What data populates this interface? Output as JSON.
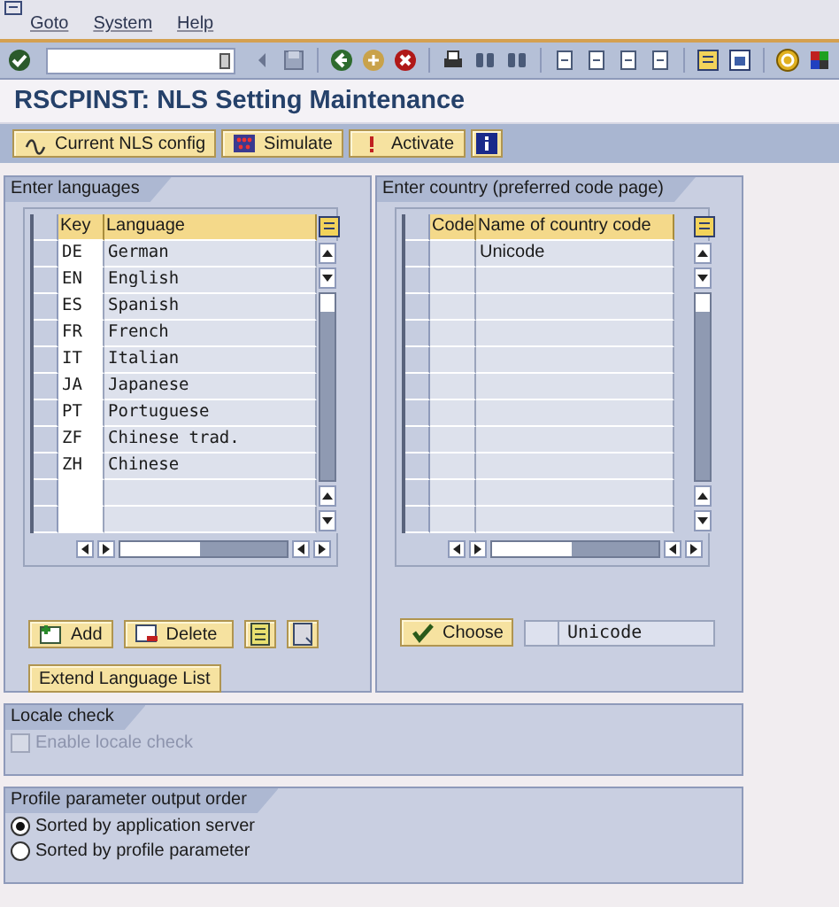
{
  "menu": [
    "Goto",
    "System",
    "Help"
  ],
  "title": "RSCPINST: NLS Setting Maintenance",
  "app_toolbar": [
    {
      "kind": "config",
      "label": "Current NLS config"
    },
    {
      "kind": "simulate",
      "label": "Simulate"
    },
    {
      "kind": "activate",
      "label": "Activate"
    },
    {
      "kind": "info"
    }
  ],
  "languages": {
    "title": "Enter languages",
    "columns": [
      "Key",
      "Language"
    ],
    "rows": [
      {
        "key": "DE",
        "language": "German"
      },
      {
        "key": "EN",
        "language": "English"
      },
      {
        "key": "ES",
        "language": "Spanish"
      },
      {
        "key": "FR",
        "language": "French"
      },
      {
        "key": "IT",
        "language": "Italian"
      },
      {
        "key": "JA",
        "language": "Japanese"
      },
      {
        "key": "PT",
        "language": "Portuguese"
      },
      {
        "key": "ZF",
        "language": "Chinese trad."
      },
      {
        "key": "ZH",
        "language": "Chinese"
      }
    ],
    "buttons": [
      {
        "kind": "add",
        "label": "Add"
      },
      {
        "kind": "delete",
        "label": "Delete"
      },
      {
        "kind": "select-all"
      },
      {
        "kind": "deselect-all"
      }
    ],
    "extend_button": "Extend Language List"
  },
  "country": {
    "title": "Enter country (preferred code page)",
    "columns": [
      "Code",
      "Name of country code"
    ],
    "rows": [
      {
        "name": "Unicode"
      }
    ],
    "choose_button": "Choose",
    "selected_value": "Unicode"
  },
  "locale_check": {
    "title": "Locale check",
    "checkbox": {
      "label": "Enable locale check",
      "checked": false,
      "disabled": true
    }
  },
  "profile_order": {
    "title": "Profile parameter output order",
    "options": [
      {
        "label": "Sorted by application server",
        "selected": true
      },
      {
        "label": "Sorted by profile parameter",
        "selected": false
      }
    ]
  }
}
